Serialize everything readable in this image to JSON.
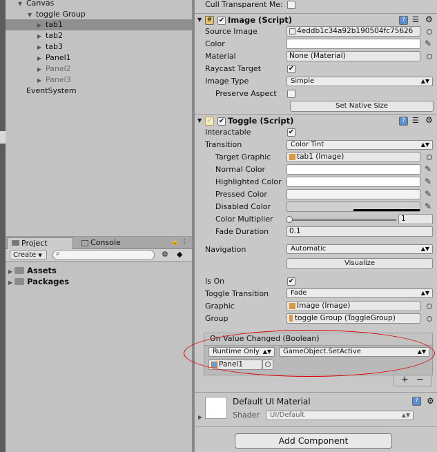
{
  "hierarchy": {
    "items": [
      {
        "label": "Canvas",
        "arrow": "▼",
        "selected": false,
        "dim": false
      },
      {
        "label": "toggle Group",
        "arrow": "▼",
        "selected": false,
        "dim": false
      },
      {
        "label": "tab1",
        "arrow": "▶",
        "selected": true,
        "dim": false
      },
      {
        "label": "tab2",
        "arrow": "▶",
        "selected": false,
        "dim": false
      },
      {
        "label": "tab3",
        "arrow": "▶",
        "selected": false,
        "dim": false
      },
      {
        "label": "Panel1",
        "arrow": "▶",
        "selected": false,
        "dim": false
      },
      {
        "label": "Panel2",
        "arrow": "▶",
        "selected": false,
        "dim": true
      },
      {
        "label": "Panel3",
        "arrow": "▶",
        "selected": false,
        "dim": true
      },
      {
        "label": "EventSystem",
        "arrow": "",
        "selected": false,
        "dim": false
      }
    ]
  },
  "project": {
    "tab_project": "Project",
    "tab_console": "Console",
    "create_label": "Create",
    "folders": [
      "Assets",
      "Packages"
    ]
  },
  "inspector": {
    "cull_label": "Cull Transparent Me:",
    "image": {
      "title": "Image (Script)",
      "source_image_label": "Source Image",
      "source_image_value": "4eddb1c34a92b190504fc75626",
      "color_label": "Color",
      "material_label": "Material",
      "material_value": "None (Material)",
      "raycast_label": "Raycast Target",
      "image_type_label": "Image Type",
      "image_type_value": "Simple",
      "preserve_label": "Preserve Aspect",
      "native_size_button": "Set Native Size"
    },
    "toggle": {
      "title": "Toggle (Script)",
      "interactable_label": "Interactable",
      "transition_label": "Transition",
      "transition_value": "Color Tint",
      "target_graphic_label": "Target Graphic",
      "target_graphic_value": "tab1 (Image)",
      "normal_label": "Normal Color",
      "highlighted_label": "Highlighted Color",
      "pressed_label": "Pressed Color",
      "disabled_label": "Disabled Color",
      "multiplier_label": "Color Multiplier",
      "multiplier_value": "1",
      "fade_label": "Fade Duration",
      "fade_value": "0.1",
      "navigation_label": "Navigation",
      "navigation_value": "Automatic",
      "visualize_button": "Visualize",
      "is_on_label": "Is On",
      "toggle_transition_label": "Toggle Transition",
      "toggle_transition_value": "Fade",
      "graphic_label": "Graphic",
      "graphic_value": "Image (Image)",
      "group_label": "Group",
      "group_value": "toggle Group (ToggleGroup)"
    },
    "event": {
      "header": "On Value Changed (Boolean)",
      "runtime_value": "Runtime Only",
      "function_value": "GameObject.SetActive",
      "object_value": "Panel1",
      "plus": "+",
      "minus": "−"
    },
    "material": {
      "name": "Default UI Material",
      "shader_label": "Shader",
      "shader_value": "UI/Default"
    },
    "add_component": "Add Component"
  },
  "colors": {
    "annotation": "#dd0000",
    "selection": "#8f8f8f",
    "panel_bg": "#c2c2c2"
  }
}
